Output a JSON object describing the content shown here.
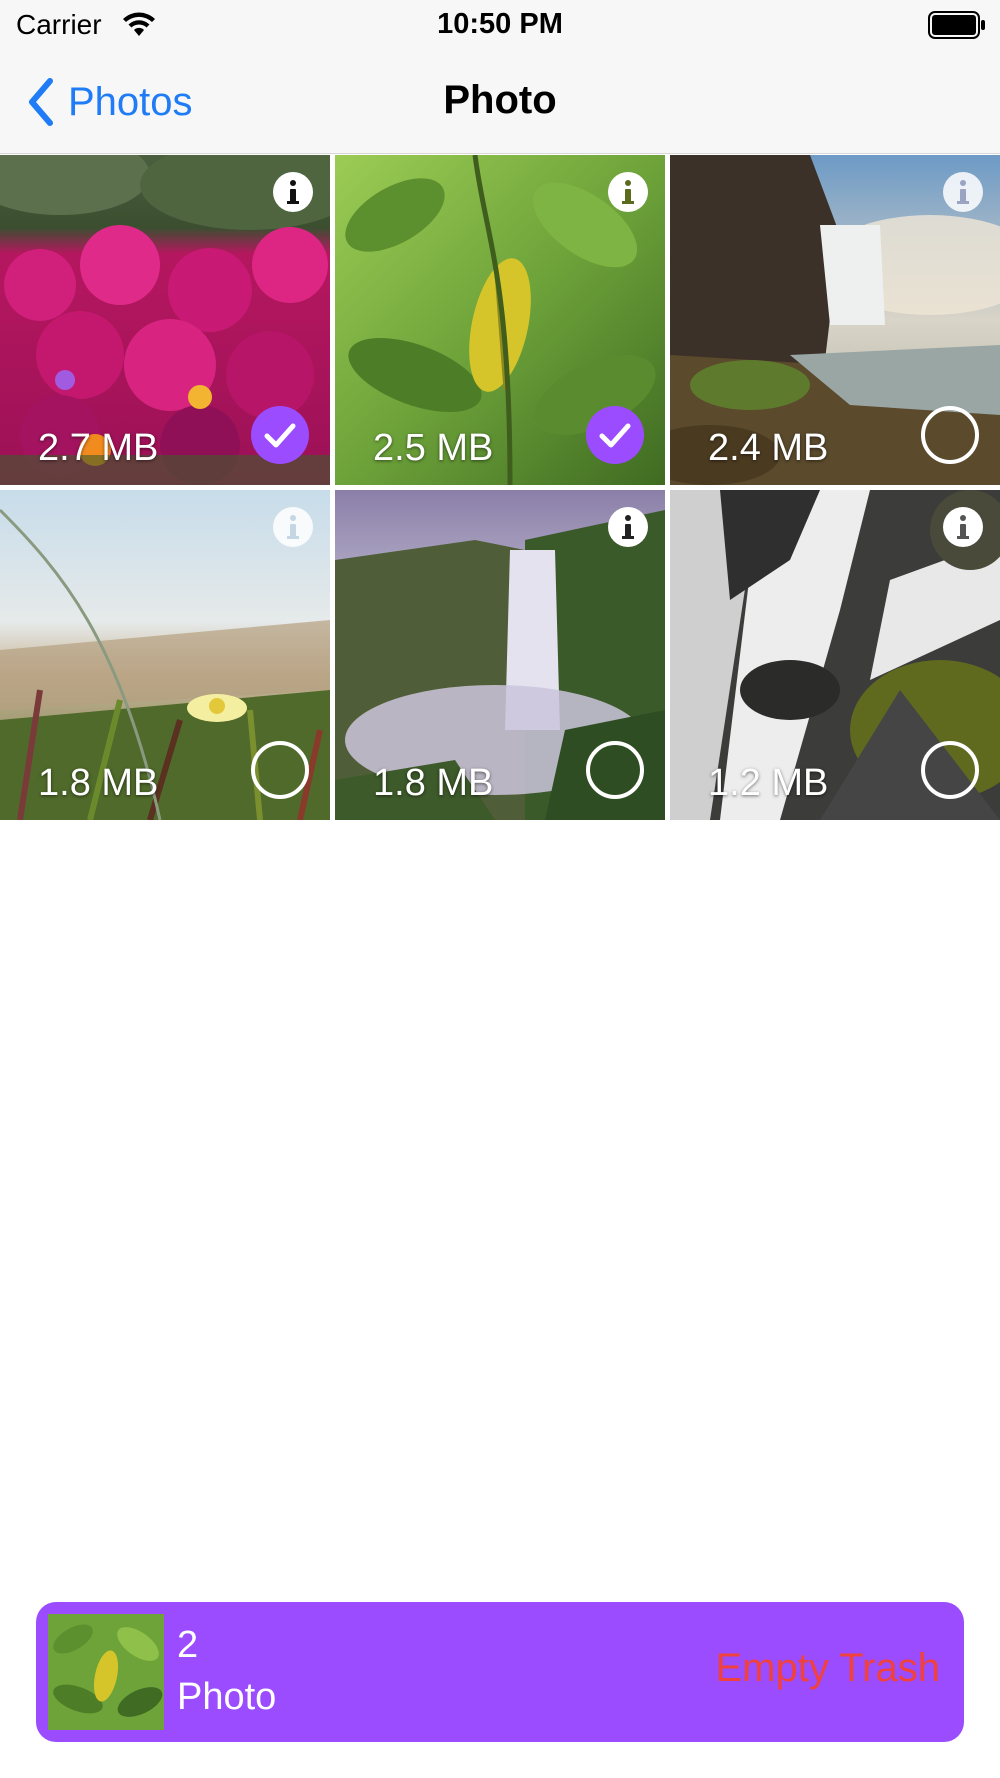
{
  "status_bar": {
    "carrier": "Carrier",
    "time": "10:50 PM"
  },
  "nav": {
    "back_label": "Photos",
    "title": "Photo"
  },
  "photos": [
    {
      "size": "2.7 MB",
      "selected": true,
      "subject": "pink flowers"
    },
    {
      "size": "2.5 MB",
      "selected": true,
      "subject": "green leaves"
    },
    {
      "size": "2.4 MB",
      "selected": false,
      "subject": "waterfall cliff"
    },
    {
      "size": "1.8 MB",
      "selected": false,
      "subject": "beach grass flower"
    },
    {
      "size": "1.8 MB",
      "selected": false,
      "subject": "misty waterfall"
    },
    {
      "size": "1.2 MB",
      "selected": false,
      "subject": "mossy waterfall"
    }
  ],
  "trash_bar": {
    "count": "2",
    "label": "Photo",
    "action_label": "Empty Trash"
  },
  "colors": {
    "accent_blue": "#1f7cf6",
    "selection_purple": "#9b4cfe",
    "destructive_red": "#f0413d"
  },
  "icons": {
    "info": "info-icon",
    "selected": "checkmark-circle-icon",
    "unselected": "empty-circle-icon",
    "back": "chevron-left-icon"
  }
}
